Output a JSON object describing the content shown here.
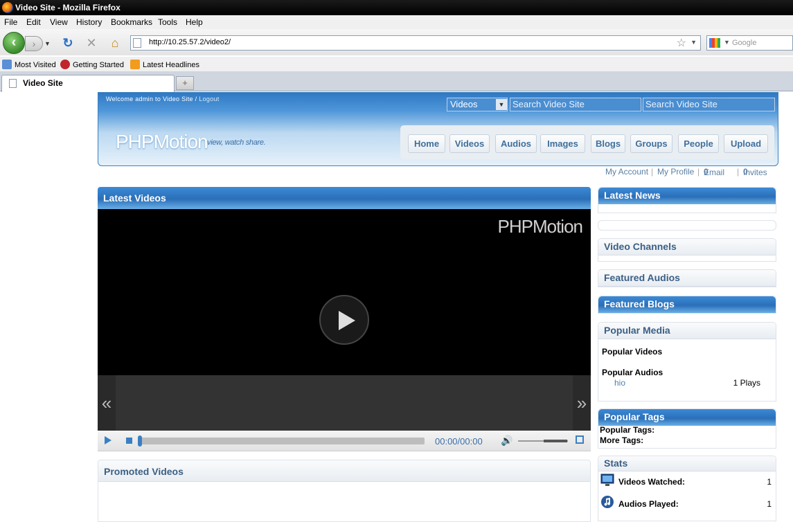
{
  "browser": {
    "window_title": "Video Site - Mozilla Firefox",
    "menu": [
      "File",
      "Edit",
      "View",
      "History",
      "Bookmarks",
      "Tools",
      "Help"
    ],
    "url": "http://10.25.57.2/video2/",
    "search_placeholder": "Google",
    "bookmarks": [
      "Most Visited",
      "Getting Started",
      "Latest Headlines"
    ],
    "tab_title": "Video Site",
    "new_tab_symbol": "+"
  },
  "header": {
    "welcome": "Welcome admin to Video Site",
    "separator": "/",
    "logout": "Logout",
    "search_type": "Videos",
    "search_field_1": "Search Video Site",
    "search_field_2": "Search Video Site",
    "logo": "PHPMotion",
    "tagline": "view, watch share.",
    "nav": [
      "Home",
      "Videos",
      "Audios",
      "Images",
      "Blogs",
      "Groups",
      "People",
      "Upload"
    ]
  },
  "account": {
    "my_account": "My Account",
    "my_profile": "My Profile",
    "email": "Email",
    "email_count": "0",
    "invites": "Invites",
    "invites_count": "0",
    "sep": "|"
  },
  "latest_videos": {
    "title": "Latest Videos",
    "watermark": "PHPMotion",
    "time": "00:00/00:00",
    "prev_symbol": "«",
    "next_symbol": "»"
  },
  "promoted_videos": {
    "title": "Promoted Videos"
  },
  "sidebar": {
    "latest_news": "Latest News",
    "video_channels": "Video Channels",
    "featured_audios": "Featured Audios",
    "featured_blogs": "Featured Blogs",
    "popular_media": {
      "title": "Popular Media",
      "popular_videos": "Popular Videos",
      "popular_audios": "Popular Audios",
      "audio_item": "hio",
      "audio_plays": "1 Plays"
    },
    "popular_tags": {
      "title": "Popular Tags",
      "popular_label": "Popular Tags:",
      "more_label": "More Tags:"
    },
    "stats": {
      "title": "Stats",
      "videos_watched_label": "Videos Watched:",
      "videos_watched": "1",
      "audios_played_label": "Audios Played:",
      "audios_played": "1"
    }
  },
  "colors": {
    "header_blue": "#2f79c4",
    "nav_text": "#3f6f9d",
    "link": "#4a7fb3"
  }
}
